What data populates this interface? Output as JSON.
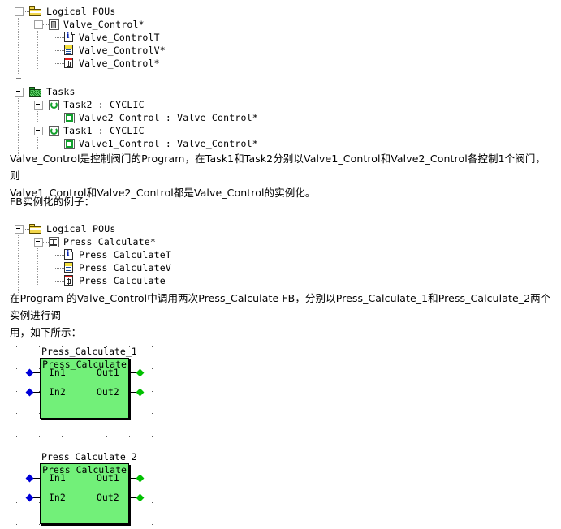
{
  "tree1": {
    "root": "Logical POUs",
    "pou": "Valve_Control*",
    "children": [
      "Valve_ControlT",
      "Valve_ControlV*",
      "Valve_Control*"
    ]
  },
  "tree2": {
    "root": "Tasks",
    "tasks": [
      {
        "name": "Task2 : CYCLIC",
        "instance": "Valve2_Control : Valve_Control*"
      },
      {
        "name": "Task1 : CYCLIC",
        "instance": "Valve1_Control : Valve_Control*"
      }
    ]
  },
  "paragraph1": {
    "line1": "Valve_Control是控制阀门的Program，在Task1和Task2分别以Valve1_Control和Valve2_Control各控制1个阀门，则",
    "line2": "Valve1_Control和Valve2_Control都是Valve_Control的实例化。"
  },
  "heading": "FB实例化的例子：",
  "tree3": {
    "root": "Logical POUs",
    "pou": "Press_Calculate*",
    "children": [
      "Press_CalculateT",
      "Press_CalculateV",
      "Press_Calculate"
    ]
  },
  "paragraph2": {
    "line1": "在Program 的Valve_Control中调用两次Press_Calculate FB，分别以Press_Calculate_1和Press_Calculate_2两个实例进行调",
    "line2": "用，如下所示："
  },
  "diagrams": [
    {
      "instance_name": "Press_Calculate_1",
      "type_name": "Press_Calculate",
      "inputs": [
        "In1",
        "In2"
      ],
      "outputs": [
        "Out1",
        "Out2"
      ]
    },
    {
      "instance_name": "Press_Calculate_2",
      "type_name": "Press_Calculate",
      "inputs": [
        "In1",
        "In2"
      ],
      "outputs": [
        "Out1",
        "Out2"
      ]
    }
  ],
  "colors": {
    "block_fill": "#72f079",
    "block_border": "#000000",
    "input_pin": "#0000d8",
    "output_pin": "#00c000",
    "folder": "#f2d64b",
    "task_green": "#12a02a"
  }
}
